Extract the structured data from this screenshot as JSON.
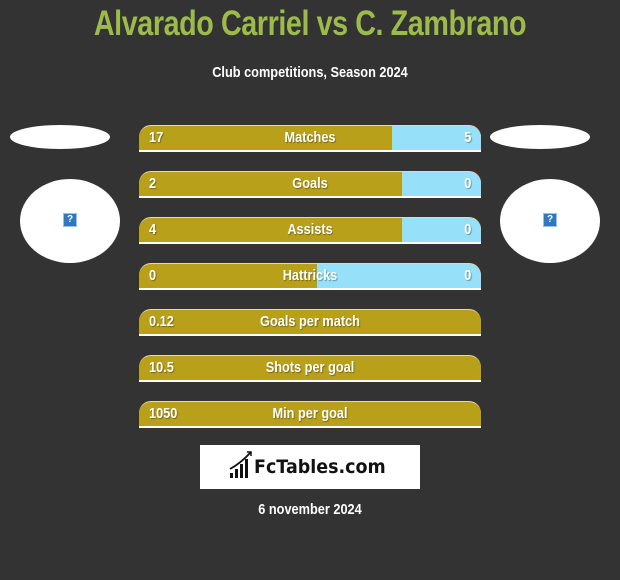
{
  "header": {
    "title": "Alvarado Carriel vs C. Zambrano",
    "subtitle": "Club competitions, Season 2024"
  },
  "players": {
    "left": {
      "name_placeholder": "",
      "image_icon": "broken-image-icon",
      "image_glyph": "?"
    },
    "right": {
      "name_placeholder": "",
      "image_icon": "broken-image-icon",
      "image_glyph": "?"
    }
  },
  "colors": {
    "background": "#333333",
    "title": "#9dbb4a",
    "left_bar": "#b8a01a",
    "right_bar": "#96e0fa"
  },
  "stats": [
    {
      "label": "Matches",
      "left": "17",
      "right": "5",
      "right_share": 0.26
    },
    {
      "label": "Goals",
      "left": "2",
      "right": "0",
      "right_share": 0.23
    },
    {
      "label": "Assists",
      "left": "4",
      "right": "0",
      "right_share": 0.23
    },
    {
      "label": "Hattricks",
      "left": "0",
      "right": "0",
      "right_share": 0.48
    },
    {
      "label": "Goals per match",
      "left": "0.12",
      "right": "",
      "right_share": 0
    },
    {
      "label": "Shots per goal",
      "left": "10.5",
      "right": "",
      "right_share": 0
    },
    {
      "label": "Min per goal",
      "left": "1050",
      "right": "",
      "right_share": 0
    }
  ],
  "footer": {
    "logo_text": "FcTables.com",
    "logo_icon": "bar-chart-icon",
    "date": "6 november 2024"
  }
}
